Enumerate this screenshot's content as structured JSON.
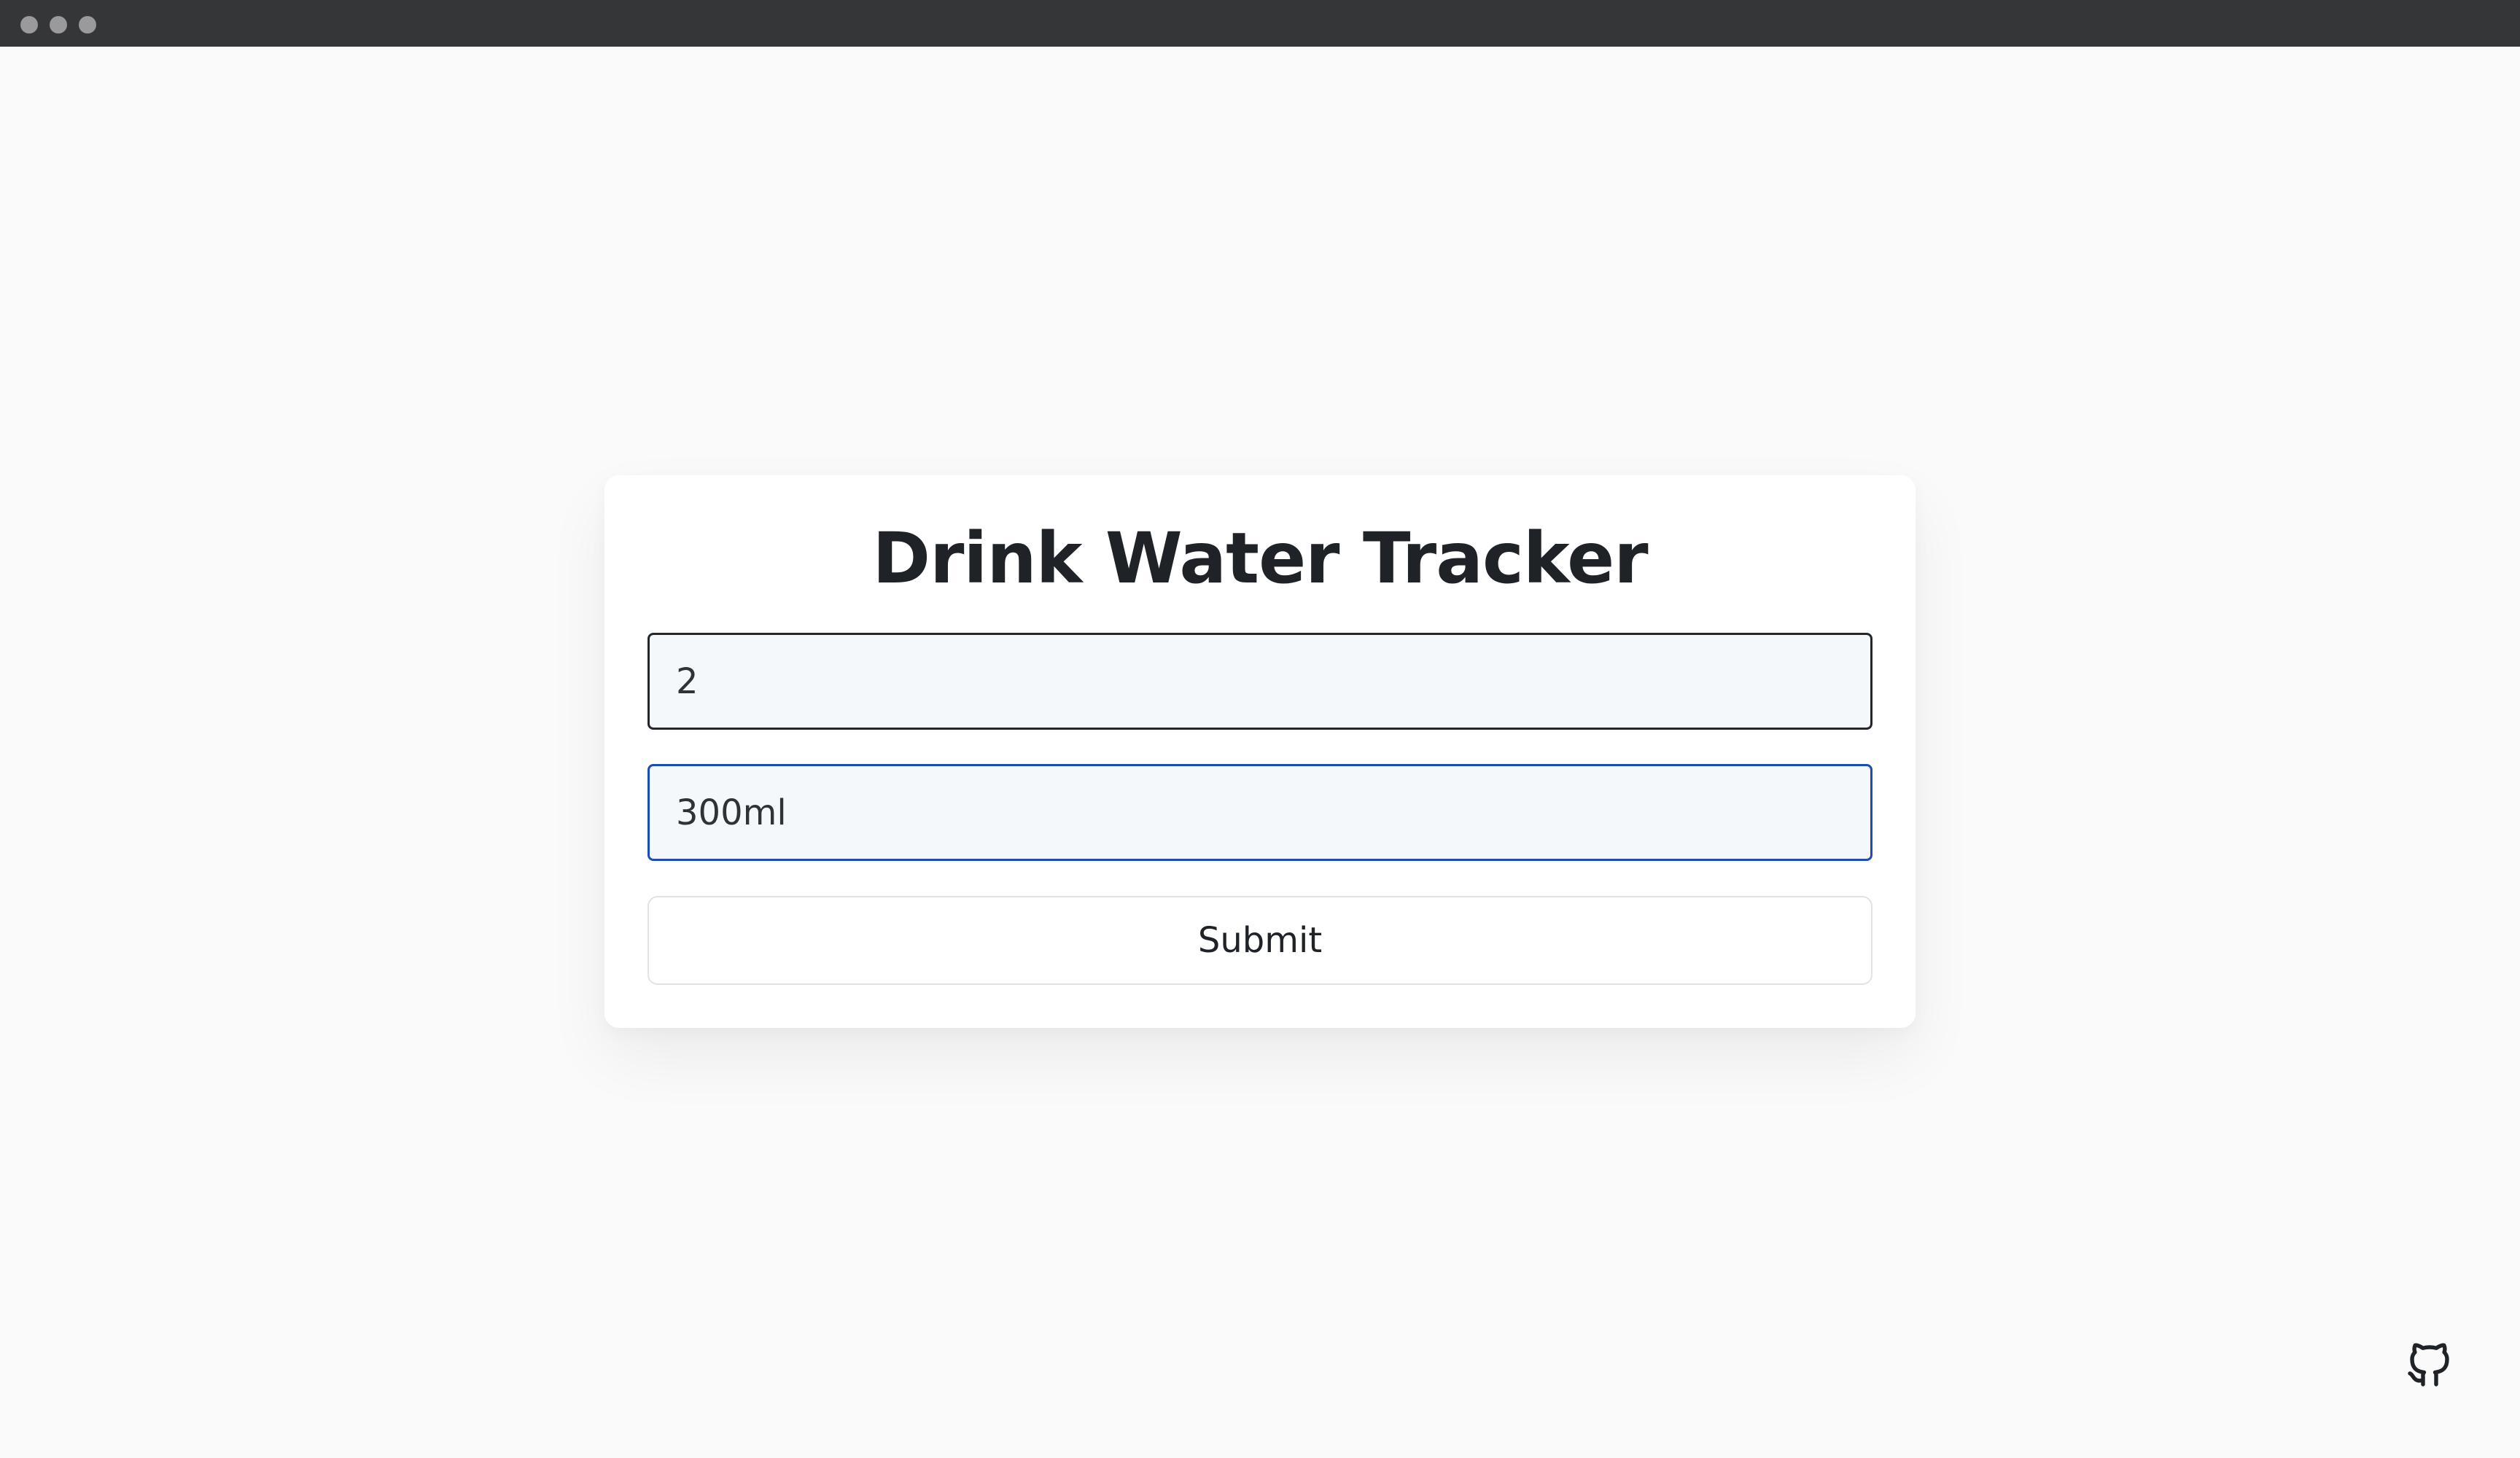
{
  "app": {
    "title": "Drink Water Tracker"
  },
  "form": {
    "count_value": "2",
    "size_value": "300ml",
    "submit_label": "Submit"
  },
  "icons": {
    "window_controls": [
      "window-dot-icon",
      "window-dot-icon",
      "window-dot-icon"
    ],
    "repo_link": "github-icon"
  },
  "colors": {
    "background": "#fafafa",
    "titlebar": "#353638",
    "card": "#ffffff",
    "input_fill": "#f5f8fb",
    "focus_border": "#1c4db0",
    "text": "#1f2328"
  }
}
